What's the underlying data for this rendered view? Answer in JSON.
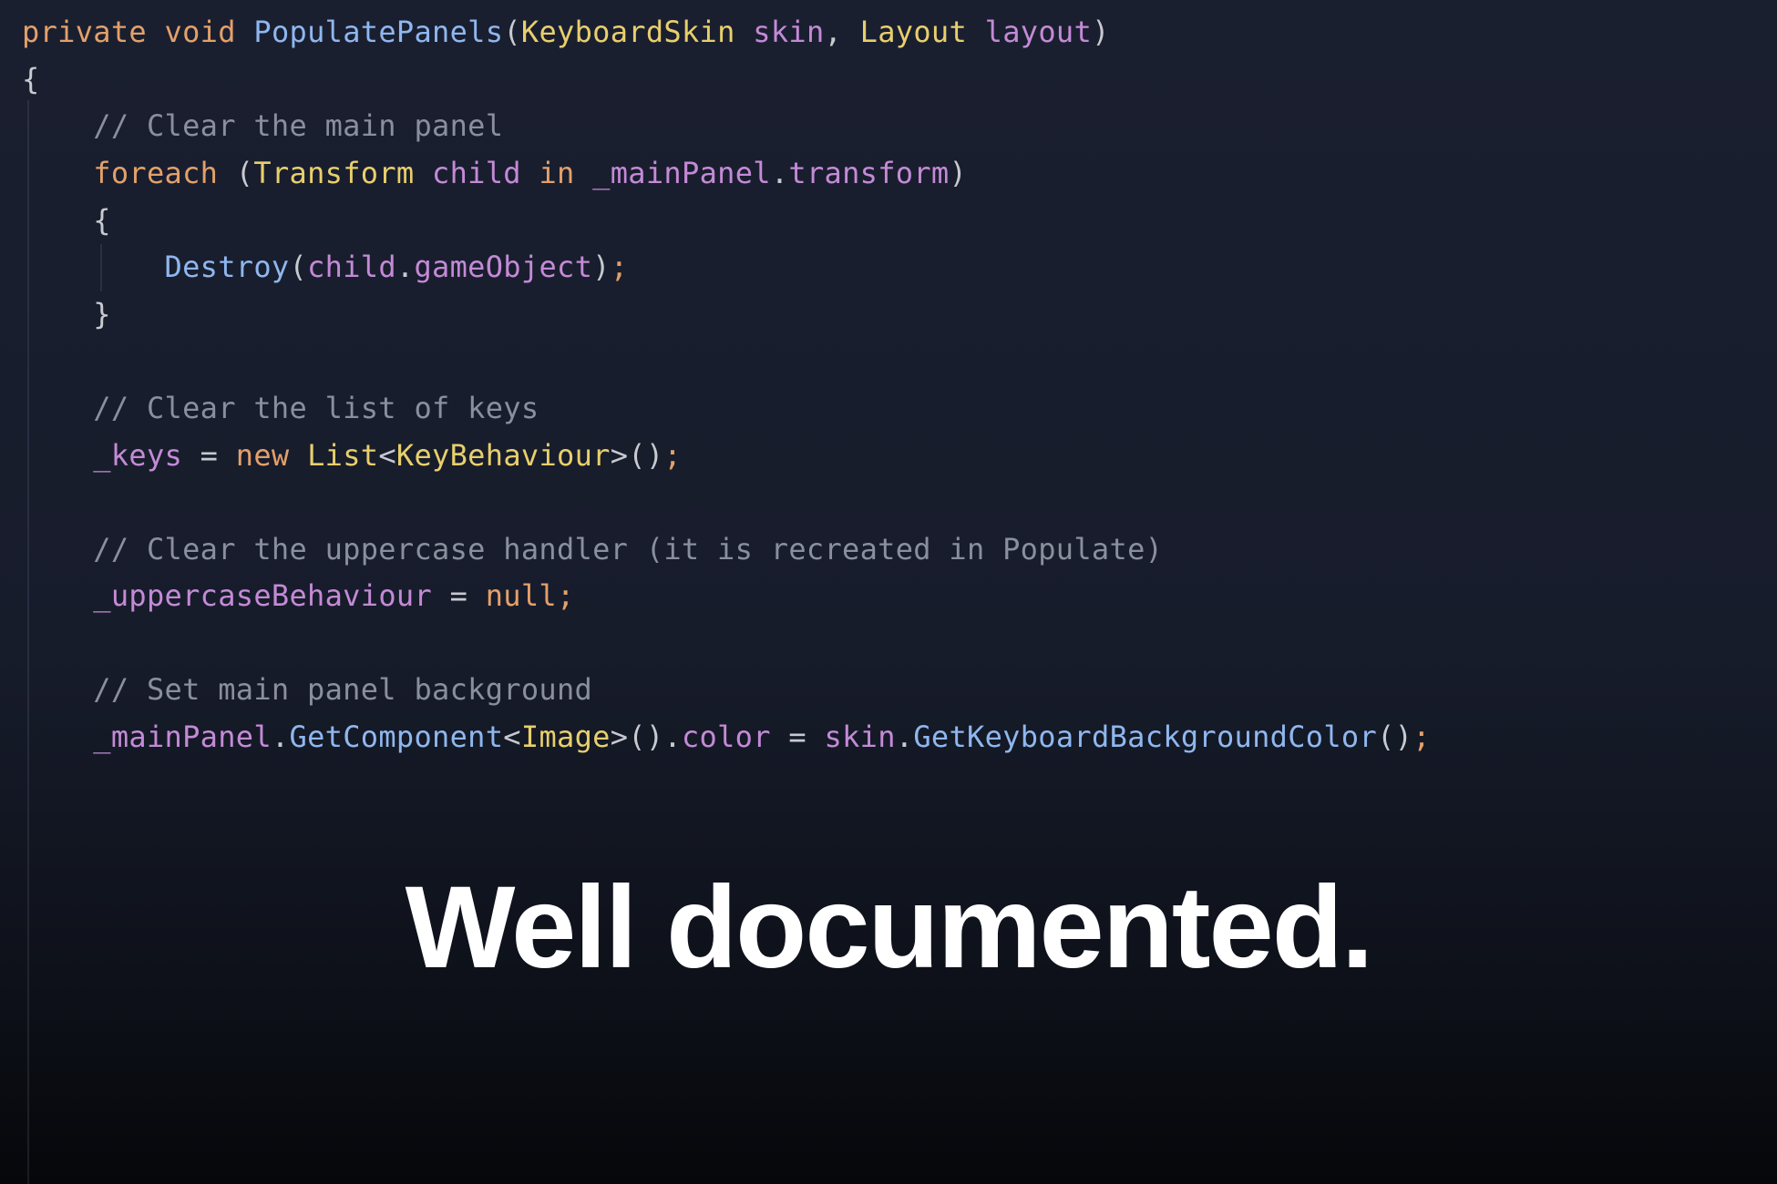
{
  "colors": {
    "background_top": "#1a1f30",
    "background_bottom": "#06070a",
    "keyword": "#e3a06a",
    "type": "#e8cf6c",
    "method": "#8fb7ef",
    "param": "#c48ad6",
    "comment": "#8a8f9d",
    "punct": "#c8cad0",
    "headline": "#ffffff"
  },
  "code": {
    "lines": [
      [
        {
          "t": "private",
          "c": "keyword"
        },
        {
          "t": " ",
          "c": "punct"
        },
        {
          "t": "void",
          "c": "keyword"
        },
        {
          "t": " ",
          "c": "punct"
        },
        {
          "t": "PopulatePanels",
          "c": "method"
        },
        {
          "t": "(",
          "c": "punct"
        },
        {
          "t": "KeyboardSkin",
          "c": "type"
        },
        {
          "t": " ",
          "c": "punct"
        },
        {
          "t": "skin",
          "c": "param"
        },
        {
          "t": ", ",
          "c": "punct"
        },
        {
          "t": "Layout",
          "c": "type"
        },
        {
          "t": " ",
          "c": "punct"
        },
        {
          "t": "layout",
          "c": "param"
        },
        {
          "t": ")",
          "c": "punct"
        }
      ],
      [
        {
          "t": "{",
          "c": "punct"
        }
      ],
      [
        {
          "t": "    // Clear the main panel",
          "c": "comment"
        }
      ],
      [
        {
          "t": "    ",
          "c": "punct"
        },
        {
          "t": "foreach",
          "c": "keyword"
        },
        {
          "t": " (",
          "c": "punct"
        },
        {
          "t": "Transform",
          "c": "type"
        },
        {
          "t": " ",
          "c": "punct"
        },
        {
          "t": "child",
          "c": "param"
        },
        {
          "t": " ",
          "c": "punct"
        },
        {
          "t": "in",
          "c": "keyword"
        },
        {
          "t": " ",
          "c": "punct"
        },
        {
          "t": "_mainPanel",
          "c": "param"
        },
        {
          "t": ".",
          "c": "punct"
        },
        {
          "t": "transform",
          "c": "param"
        },
        {
          "t": ")",
          "c": "punct"
        }
      ],
      [
        {
          "t": "    {",
          "c": "punct"
        }
      ],
      [
        {
          "t": "        ",
          "c": "punct"
        },
        {
          "t": "Destroy",
          "c": "method"
        },
        {
          "t": "(",
          "c": "punct"
        },
        {
          "t": "child",
          "c": "param"
        },
        {
          "t": ".",
          "c": "punct"
        },
        {
          "t": "gameObject",
          "c": "param"
        },
        {
          "t": ")",
          "c": "punct"
        },
        {
          "t": ";",
          "c": "keyword"
        }
      ],
      [
        {
          "t": "    }",
          "c": "punct"
        }
      ],
      [],
      [
        {
          "t": "    // Clear the list of keys",
          "c": "comment"
        }
      ],
      [
        {
          "t": "    ",
          "c": "punct"
        },
        {
          "t": "_keys",
          "c": "param"
        },
        {
          "t": " = ",
          "c": "punct"
        },
        {
          "t": "new",
          "c": "keyword"
        },
        {
          "t": " ",
          "c": "punct"
        },
        {
          "t": "List",
          "c": "type"
        },
        {
          "t": "<",
          "c": "punct"
        },
        {
          "t": "KeyBehaviour",
          "c": "type"
        },
        {
          "t": ">()",
          "c": "punct"
        },
        {
          "t": ";",
          "c": "keyword"
        }
      ],
      [],
      [
        {
          "t": "    // Clear the uppercase handler (it is recreated in Populate)",
          "c": "comment"
        }
      ],
      [
        {
          "t": "    ",
          "c": "punct"
        },
        {
          "t": "_uppercaseBehaviour",
          "c": "param"
        },
        {
          "t": " = ",
          "c": "punct"
        },
        {
          "t": "null",
          "c": "keyword"
        },
        {
          "t": ";",
          "c": "keyword"
        }
      ],
      [],
      [
        {
          "t": "    // Set main panel background",
          "c": "comment"
        }
      ],
      [
        {
          "t": "    ",
          "c": "punct"
        },
        {
          "t": "_mainPanel",
          "c": "param"
        },
        {
          "t": ".",
          "c": "punct"
        },
        {
          "t": "GetComponent",
          "c": "method"
        },
        {
          "t": "<",
          "c": "punct"
        },
        {
          "t": "Image",
          "c": "type"
        },
        {
          "t": ">().",
          "c": "punct"
        },
        {
          "t": "color",
          "c": "param"
        },
        {
          "t": " = ",
          "c": "punct"
        },
        {
          "t": "skin",
          "c": "param"
        },
        {
          "t": ".",
          "c": "punct"
        },
        {
          "t": "GetKeyboardBackgroundColor",
          "c": "method"
        },
        {
          "t": "()",
          "c": "punct"
        },
        {
          "t": ";",
          "c": "keyword"
        }
      ]
    ]
  },
  "headline": {
    "text": "Well documented."
  }
}
